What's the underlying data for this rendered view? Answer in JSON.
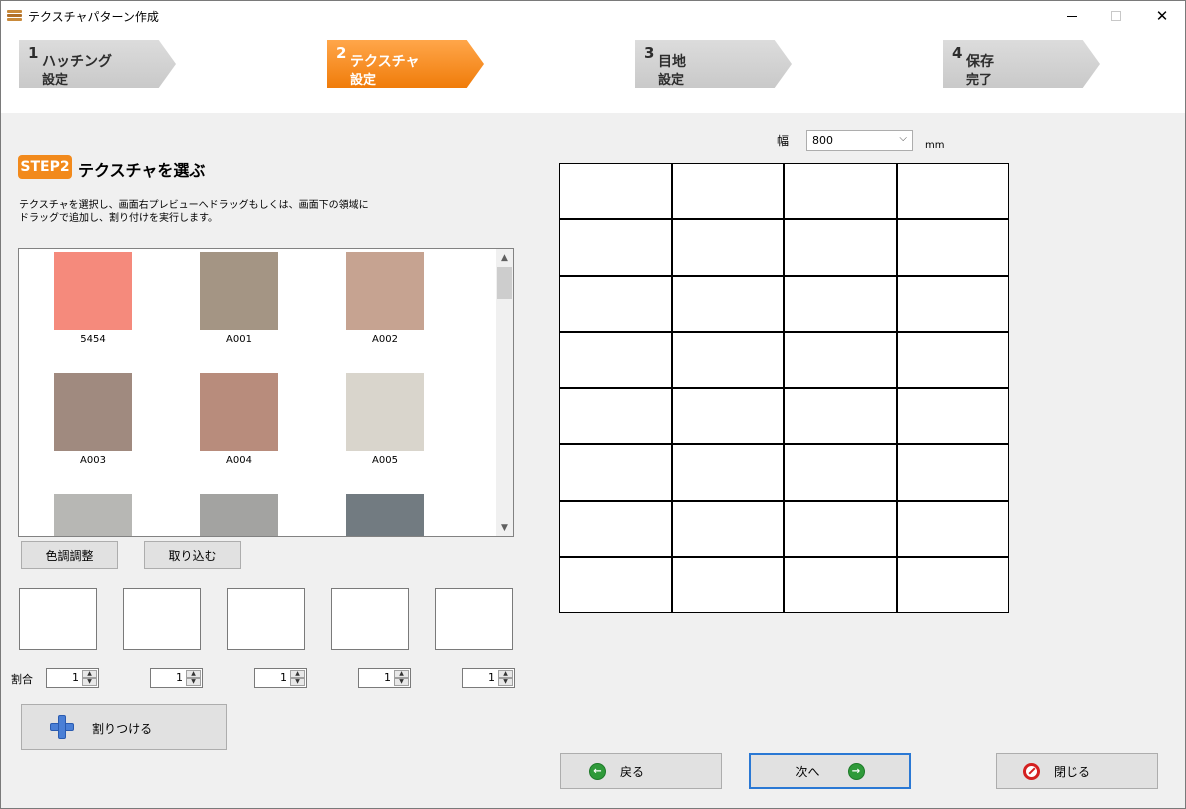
{
  "window": {
    "title": "テクスチャパターン作成"
  },
  "steps": [
    {
      "num": "1",
      "line1": "ハッチング",
      "line2": "設定"
    },
    {
      "num": "2",
      "line1": "テクスチャ",
      "line2": "設定"
    },
    {
      "num": "3",
      "line1": "目地",
      "line2": "設定"
    },
    {
      "num": "4",
      "line1": "保存",
      "line2": "完了"
    }
  ],
  "section": {
    "badge": "STEP2",
    "title": "テクスチャを選ぶ",
    "instructions_line1": "テクスチャを選択し、画面右プレビューへドラッグもしくは、画面下の領域に",
    "instructions_line2": "ドラッグで追加し、割り付けを実行します。"
  },
  "textures": [
    {
      "label": "5454",
      "color": "#f58a7c"
    },
    {
      "label": "A001",
      "color": "#a49584"
    },
    {
      "label": "A002",
      "color": "#c6a391"
    },
    {
      "label": "A003",
      "color": "#a08a7f"
    },
    {
      "label": "A004",
      "color": "#b88c7c"
    },
    {
      "label": "A005",
      "color": "#d9d5cc"
    },
    {
      "label": "",
      "color": "#b7b7b4"
    },
    {
      "label": "",
      "color": "#a3a3a1"
    },
    {
      "label": "",
      "color": "#727b81"
    }
  ],
  "buttons": {
    "color_adjust": "色調調整",
    "import": "取り込む",
    "assign": "割りつける",
    "back": "戻る",
    "next": "次へ",
    "close": "閉じる"
  },
  "ratio": {
    "label": "割合",
    "values": [
      "1",
      "1",
      "1",
      "1",
      "1"
    ]
  },
  "preview": {
    "width_label": "幅",
    "width_value": "800",
    "unit": "mm"
  }
}
